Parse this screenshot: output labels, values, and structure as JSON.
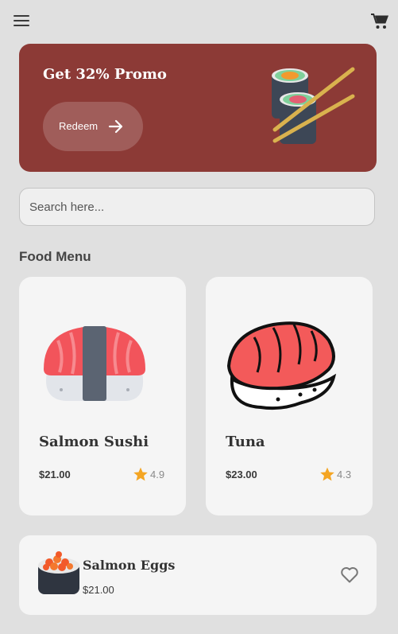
{
  "header": {
    "menu_icon": "hamburger-menu-icon",
    "cart_icon": "shopping-cart-icon"
  },
  "promo": {
    "title": "Get 32% Promo",
    "button_label": "Redeem",
    "arrow_icon": "arrow-right-icon",
    "background": "#8c3a36"
  },
  "search": {
    "placeholder": "Search here..."
  },
  "section": {
    "title": "Food Menu"
  },
  "menu_cards": [
    {
      "name": "Salmon Sushi",
      "price": "$21.00",
      "rating": "4.9"
    },
    {
      "name": "Tuna",
      "price": "$23.00",
      "rating": "4.3"
    }
  ],
  "list_items": [
    {
      "name": "Salmon Eggs",
      "price": "$21.00",
      "icon": "heart-outline-icon"
    }
  ],
  "colors": {
    "star": "#f4a523",
    "card": "#f5f5f5",
    "page": "#e0e0e0"
  }
}
